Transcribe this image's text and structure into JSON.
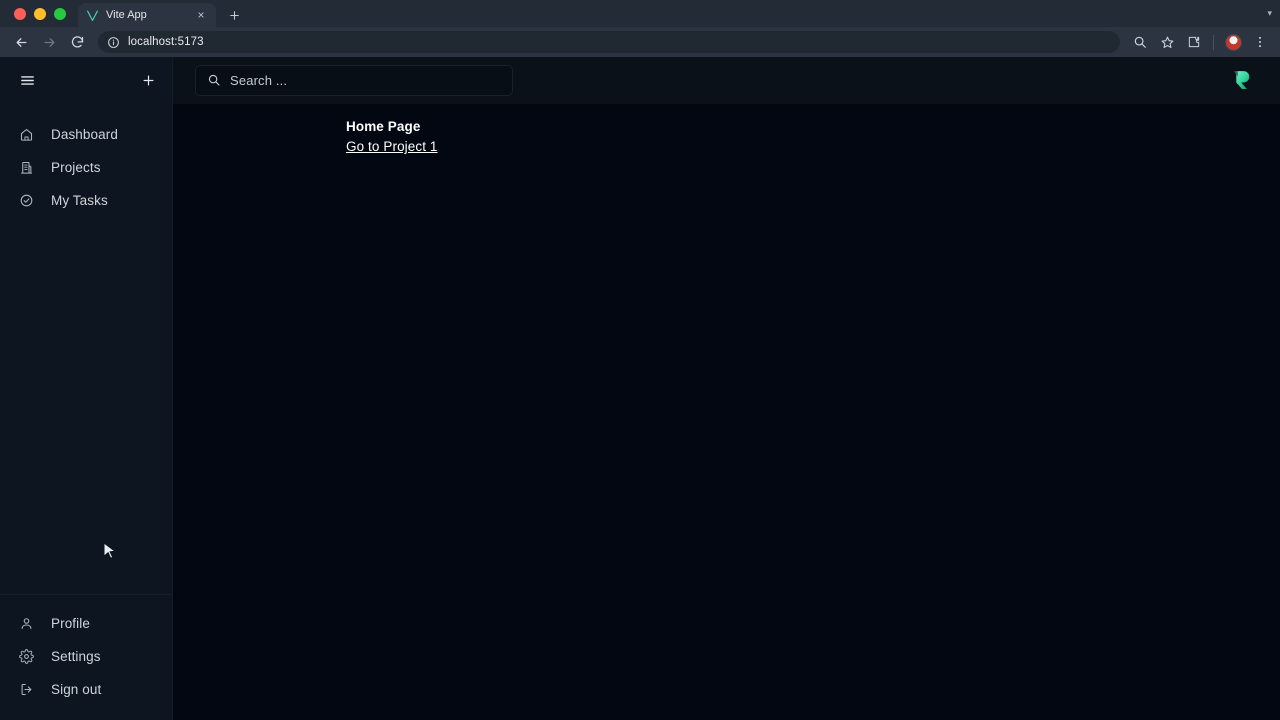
{
  "browser": {
    "window_controls": [
      "close",
      "minimize",
      "maximize"
    ],
    "tab": {
      "title": "Vite App",
      "favicon": "vite-logo-icon",
      "close_label": "×"
    },
    "new_tab_label": "+",
    "tab_list_chevron": "▾",
    "nav": {
      "back_label": "←",
      "forward_label": "→",
      "reload_label": "↻"
    },
    "omnibox": {
      "site_info_icon": "info-circle-icon",
      "url": "localhost:5173"
    },
    "toolbar_icons": [
      {
        "name": "zoom-search-icon"
      },
      {
        "name": "bookmark-star-icon"
      },
      {
        "name": "extensions-puzzle-icon"
      },
      {
        "name": "profile-avatar-icon"
      },
      {
        "name": "chrome-menu-icon"
      }
    ]
  },
  "app": {
    "sidebar": {
      "menu_toggle_icon": "hamburger-menu-icon",
      "add_icon": "plus-icon",
      "items": [
        {
          "label": "Dashboard",
          "icon": "home-icon"
        },
        {
          "label": "Projects",
          "icon": "building-icon"
        },
        {
          "label": "My Tasks",
          "icon": "check-circle-icon"
        }
      ],
      "bottom_items": [
        {
          "label": "Profile",
          "icon": "user-icon"
        },
        {
          "label": "Settings",
          "icon": "gear-icon"
        },
        {
          "label": "Sign out",
          "icon": "logout-icon"
        }
      ]
    },
    "header": {
      "search": {
        "icon": "search-icon",
        "value": "",
        "placeholder": "Search ..."
      },
      "logo": {
        "name": "app-logo-r-mark",
        "color_start": "#5eead4",
        "color_end": "#10b981"
      }
    },
    "content": {
      "title": "Home Page",
      "link": "Go to Project 1"
    }
  },
  "theme": {
    "app_background": "#020712",
    "sidebar_background": "#0d1620",
    "header_background": "#0b1118",
    "text_primary": "#ffffff",
    "text_secondary": "#ced4dc",
    "chrome_tabstrip": "#222b36",
    "chrome_toolbar": "#2b3440"
  }
}
